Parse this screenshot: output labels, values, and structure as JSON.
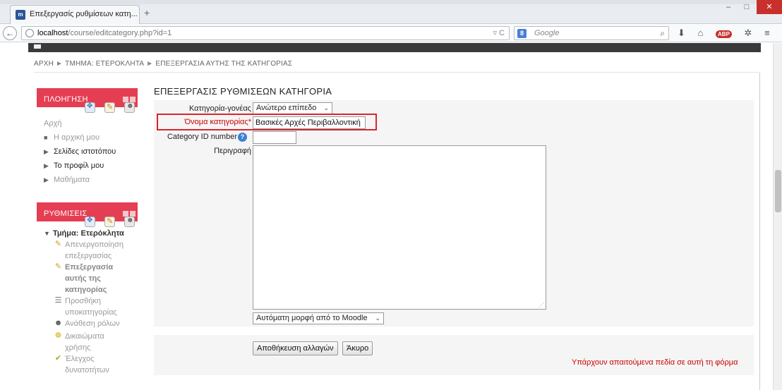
{
  "browser": {
    "tab_title": "Επεξεργασίς ρυθμίσεων κατη...",
    "tab_favicon": "m",
    "new_tab": "+",
    "url_host": "localhost",
    "url_path": "/course/editcategory.php?id=1",
    "search_engine": "8",
    "search_placeholder": "Google",
    "window_controls": {
      "minimize": "–",
      "maximize": "□",
      "close": "✕"
    },
    "abp_label": "ABP"
  },
  "breadcrumb": [
    "ΑΡΧΗ",
    "ΤΜΗΜΑ: ΕΤΕΡΟΚΛΗΤΑ",
    "ΕΠΕΞΕΡΓΑΣΙΑ ΑΥΤΗΣ ΤΗΣ ΚΑΤΗΓΟΡΙΑΣ"
  ],
  "breadcrumb_sep": "►",
  "navigation_block": {
    "title": "ΠΛΟΗΓΗΣΗ",
    "items": [
      {
        "label": "Αρχή",
        "marker": ""
      },
      {
        "label": "Η αρχική μου",
        "marker": "■"
      },
      {
        "label": "Σελίδες ιστοτόπου",
        "marker": "▶"
      },
      {
        "label": "Το προφίλ μου",
        "marker": "▶"
      },
      {
        "label": "Μαθήματα",
        "marker": "▶"
      }
    ]
  },
  "settings_block": {
    "title": "ΡΥΘΜΙΣΕΙΣ",
    "section": "Τμήμα: Ετερόκλητα",
    "section_marker": "▼",
    "items": [
      {
        "lines": [
          "Απενεργοποίηση",
          "επεξεργασίας"
        ],
        "icon": "pencil-icon"
      },
      {
        "lines": [
          "Επεξεργασία",
          "αυτής της",
          "κατηγορίας"
        ],
        "icon": "pencil-icon"
      },
      {
        "lines": [
          "Προσθήκη",
          "υποκατηγορίας"
        ],
        "icon": "list-icon"
      },
      {
        "lines": [
          "Ανάθεση ρόλων"
        ],
        "icon": "user-icon"
      },
      {
        "lines": [
          "Δικαιώματα",
          "χρήσης"
        ],
        "icon": "badge-icon"
      },
      {
        "lines": [
          "Έλεγχος",
          "δυνατοτήτων"
        ],
        "icon": "check-icon"
      }
    ]
  },
  "form": {
    "title": "ΕΠΕΞΕΡΓΑΣΙΣ ΡΥΘΜΙΣΕΩΝ ΚΑΤΗΓΟΡΙΑ",
    "parent_label": "Κατηγορία-γονέας",
    "parent_value": "Ανώτερο επίπεδο",
    "name_label": "Όνομα κατηγορίας",
    "required_mark": "*",
    "name_value": "Βασικές Αρχές Περιβαλλοντική",
    "idnumber_label": "Category ID number",
    "idnumber_value": "",
    "description_label": "Περιγραφή",
    "format_value": "Αυτόματη μορφή από το Moodle",
    "save_label": "Αποθήκευση αλλαγών",
    "cancel_label": "Άκυρο",
    "required_note": "Υπάρχουν απαιτούμενα πεδία σε αυτή τη φόρμα"
  },
  "colors": {
    "block_header": "#e53e52",
    "required": "#cc0000",
    "highlight_box": "#d7262c"
  }
}
